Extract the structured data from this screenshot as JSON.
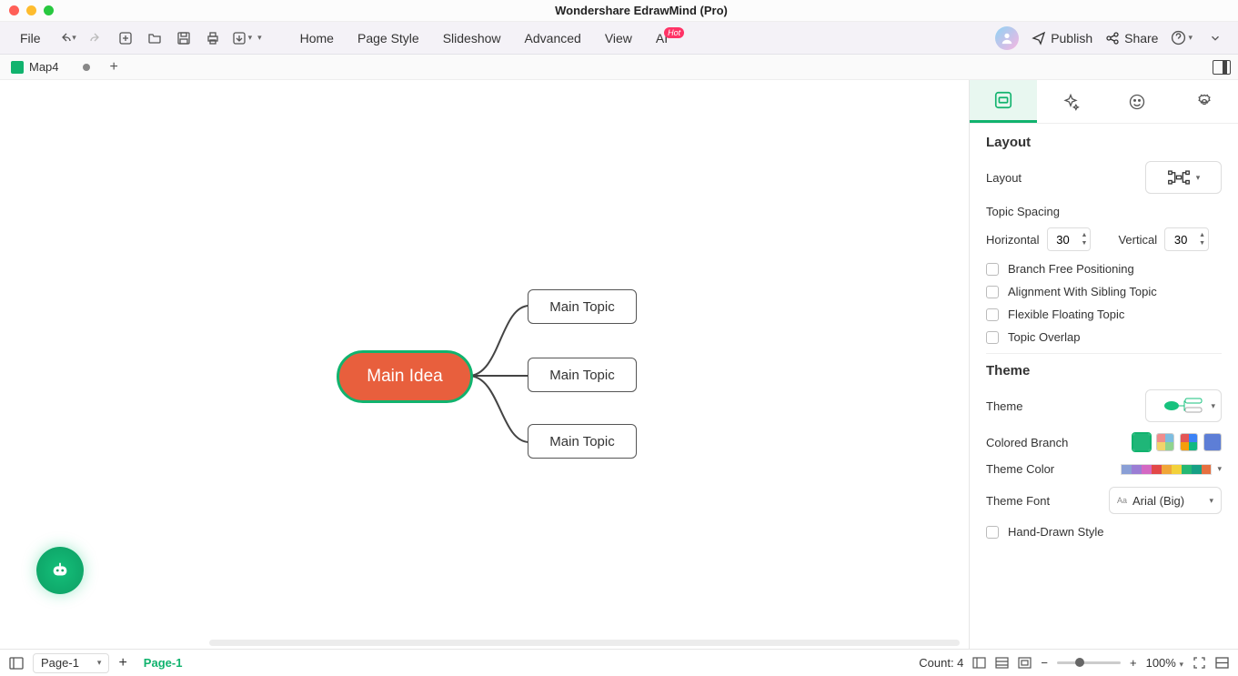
{
  "titlebar": {
    "title": "Wondershare EdrawMind (Pro)"
  },
  "toolbar": {
    "file": "File",
    "menus": [
      "Home",
      "Page Style",
      "Slideshow",
      "Advanced",
      "View",
      "AI"
    ],
    "hot": "Hot",
    "publish": "Publish",
    "share": "Share"
  },
  "tabs": {
    "name": "Map4"
  },
  "mindmap": {
    "root": "Main Idea",
    "topics": [
      "Main Topic",
      "Main Topic",
      "Main Topic"
    ]
  },
  "panel": {
    "layout_title": "Layout",
    "layout_label": "Layout",
    "topic_spacing": "Topic Spacing",
    "horizontal": "Horizontal",
    "h_val": "30",
    "vertical": "Vertical",
    "v_val": "30",
    "chk1": "Branch Free Positioning",
    "chk2": "Alignment With Sibling Topic",
    "chk3": "Flexible Floating Topic",
    "chk4": "Topic Overlap",
    "theme_title": "Theme",
    "theme_label": "Theme",
    "colored_branch": "Colored Branch",
    "theme_color": "Theme Color",
    "theme_font": "Theme Font",
    "font_value": "Arial (Big)",
    "hand_drawn": "Hand-Drawn Style"
  },
  "status": {
    "page_dd": "Page-1",
    "page_active": "Page-1",
    "count": "Count: 4",
    "zoom": "100%"
  }
}
